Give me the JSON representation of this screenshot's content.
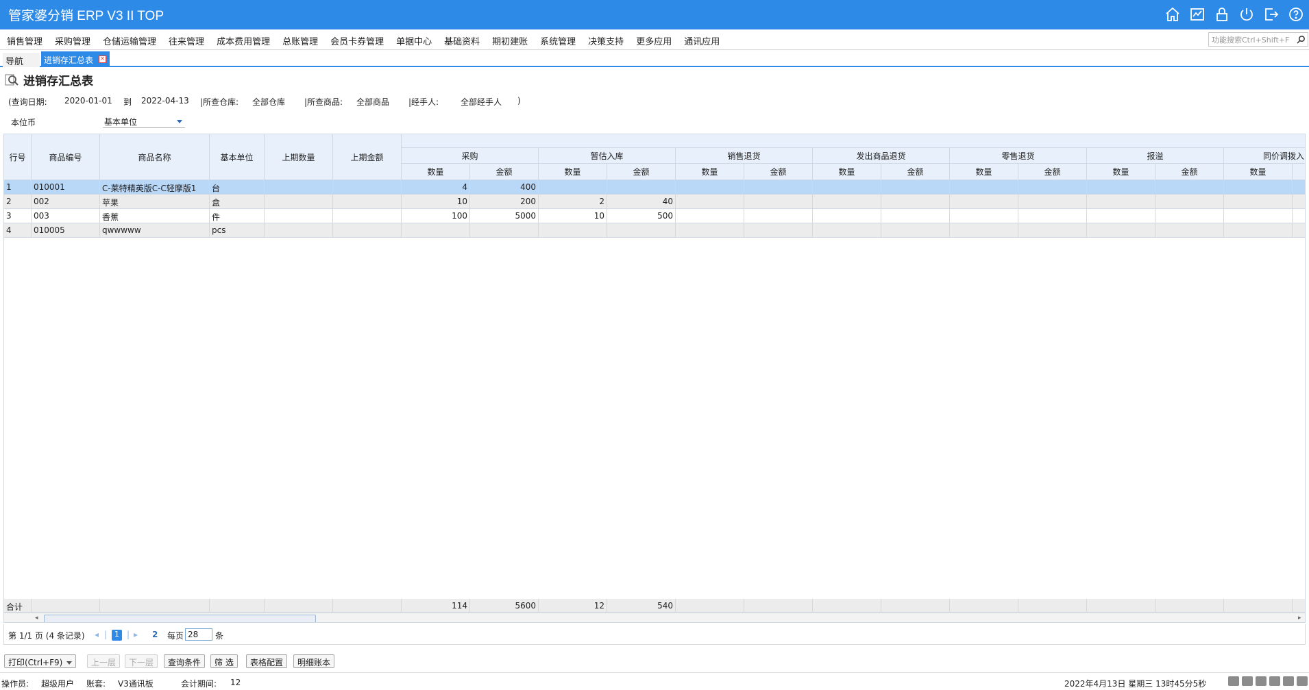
{
  "app": {
    "title": "管家婆分销 ERP V3 II TOP"
  },
  "top_icons": [
    "home-icon",
    "chart-icon",
    "lock-icon",
    "power-icon",
    "exit-icon",
    "help-icon"
  ],
  "menu": [
    "销售管理",
    "采购管理",
    "仓储运输管理",
    "往来管理",
    "成本费用管理",
    "总账管理",
    "会员卡券管理",
    "单据中心",
    "基础资料",
    "期初建账",
    "系统管理",
    "决策支持",
    "更多应用",
    "通讯应用"
  ],
  "search": {
    "placeholder": "功能搜索Ctrl+Shift+F"
  },
  "tabs": {
    "nav": "导航",
    "active": "进销存汇总表"
  },
  "page": {
    "title": "进销存汇总表"
  },
  "filters": {
    "date_label": "(查询日期:",
    "date_from": "2020-01-01",
    "to": "到",
    "date_to": "2022-04-13",
    "warehouse_label": "|所查仓库:",
    "warehouse": "全部仓库",
    "product_label": "|所查商品:",
    "product": "全部商品",
    "handler_label": "|经手人:",
    "handler": "全部经手人",
    "close": ")"
  },
  "unit": {
    "label": "本位币",
    "selected": "基本单位"
  },
  "table": {
    "headers": {
      "row_no": "行号",
      "code": "商品编号",
      "name": "商品名称",
      "unit": "基本单位",
      "prev_qty": "上期数量",
      "prev_amt": "上期金额",
      "groups": [
        "采购",
        "暂估入库",
        "销售退货",
        "发出商品退货",
        "零售退货",
        "报溢",
        "同价调拨入"
      ],
      "qty": "数量",
      "amt": "金额"
    },
    "rows": [
      {
        "no": "1",
        "code": "010001",
        "name": "C-莱特精英版C-C轻摩版1",
        "unit": "台",
        "buy_qty": "4",
        "buy_amt": "400",
        "est_qty": "",
        "est_amt": ""
      },
      {
        "no": "2",
        "code": "002",
        "name": "苹果",
        "unit": "盒",
        "buy_qty": "10",
        "buy_amt": "200",
        "est_qty": "2",
        "est_amt": "40"
      },
      {
        "no": "3",
        "code": "003",
        "name": "香蕉",
        "unit": "件",
        "buy_qty": "100",
        "buy_amt": "5000",
        "est_qty": "10",
        "est_amt": "500"
      },
      {
        "no": "4",
        "code": "010005",
        "name": "qwwwww",
        "unit": "pcs",
        "buy_qty": "",
        "buy_amt": "",
        "est_qty": "",
        "est_amt": ""
      }
    ],
    "footer": {
      "label": "合计",
      "buy_qty": "114",
      "buy_amt": "5600",
      "est_qty": "12",
      "est_amt": "540"
    }
  },
  "pager": {
    "info": "第 1/1 页 (4 条记录)",
    "current": "1",
    "next": "2",
    "per_page_label": "每页",
    "per_page": "28",
    "unit": "条"
  },
  "buttons": {
    "print": "打印(Ctrl+F9)",
    "up": "上一层",
    "down": "下一层",
    "query": "查询条件",
    "filter": "筛 选",
    "table_config": "表格配置",
    "detail": "明细账本"
  },
  "status": {
    "operator_label": "操作员:",
    "operator": "超级用户",
    "account_label": "账套:",
    "account": "V3通讯板",
    "period_label": "会计期间:",
    "period": "12",
    "datetime": "2022年4月13日  星期三  13时45分5秒"
  }
}
